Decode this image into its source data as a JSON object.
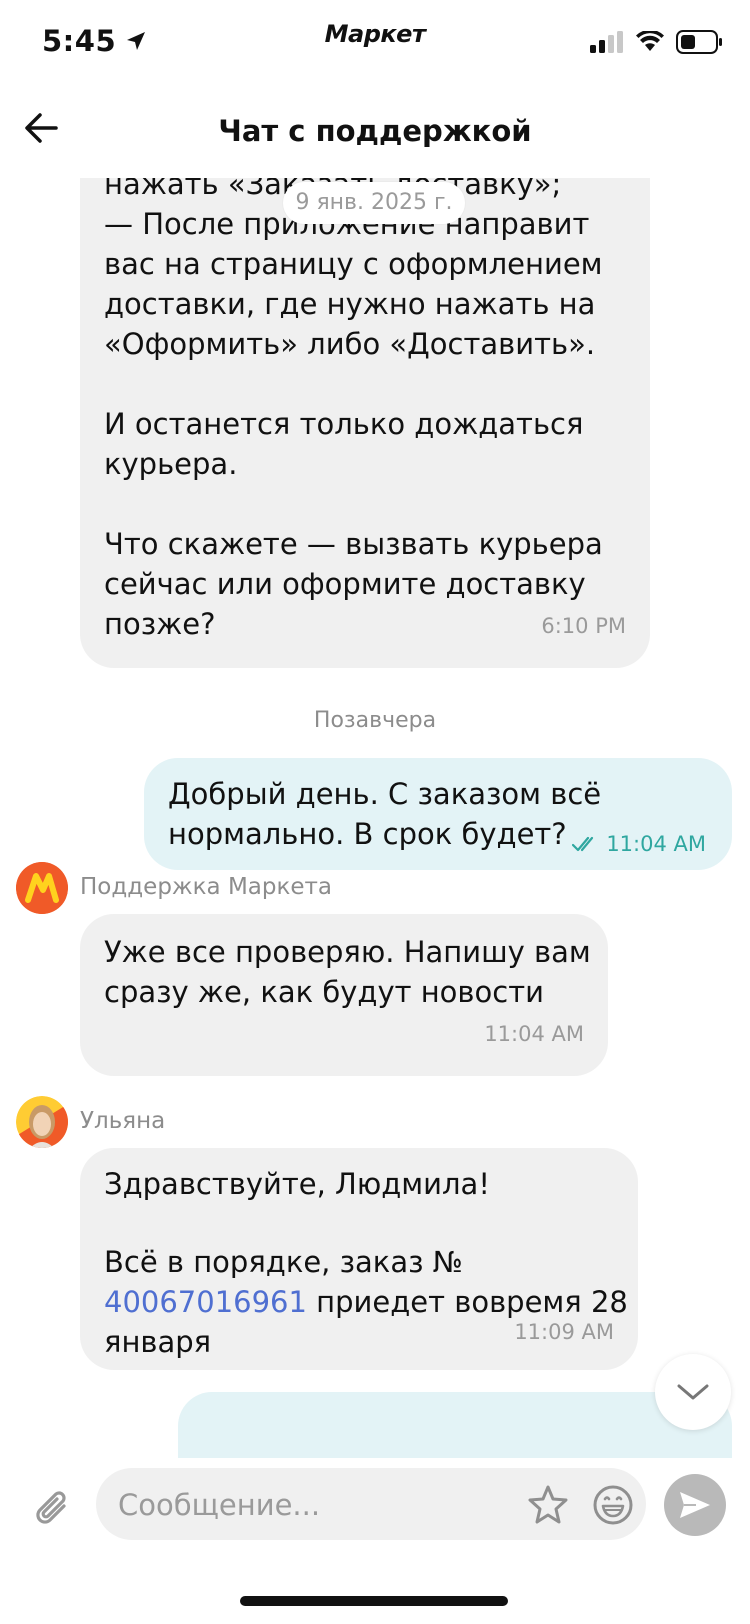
{
  "status_bar": {
    "time": "5:45",
    "brand": "Маркет"
  },
  "header": {
    "title": "Чат с поддержкой"
  },
  "chat": {
    "date_pill": "9 янв. 2025 г.",
    "msg1": {
      "lines": [
        "нажать «Заказать доставку»;",
        "— После приложение направит",
        "вас на страницу с оформлением",
        "доставки, где нужно нажать на",
        "«Оформить» либо «Доставить».",
        "",
        "И останется только дождаться",
        "курьера.",
        "",
        "Что скажете — вызвать курьера",
        "сейчас или оформите доставку",
        "позже?"
      ],
      "time": "6:10 PM"
    },
    "day_separator": "Позавчера",
    "msg2": {
      "line1": "Добрый день. С заказом всё",
      "line2": "нормально. В срок будет?",
      "time": "11:04 AM"
    },
    "msg3": {
      "sender": "Поддержка Маркета",
      "line1": "Уже все проверяю. Напишу вам",
      "line2": "сразу же, как будут новости",
      "time": "11:04 AM"
    },
    "msg4": {
      "sender": "Ульяна",
      "line1": "Здравствуйте, Людмила!",
      "line2": "Всё в порядке, заказ №",
      "order_link": "40067016961",
      "line3_rest": " приедет вовремя 28",
      "line4": "января",
      "time": "11:09 AM"
    }
  },
  "input": {
    "placeholder": "Сообщение..."
  },
  "colors": {
    "outgoing_bubble": "#e3f3f6",
    "incoming_bubble": "#f0f0f0",
    "link": "#4f6fd1",
    "check": "#2fa7a0"
  }
}
